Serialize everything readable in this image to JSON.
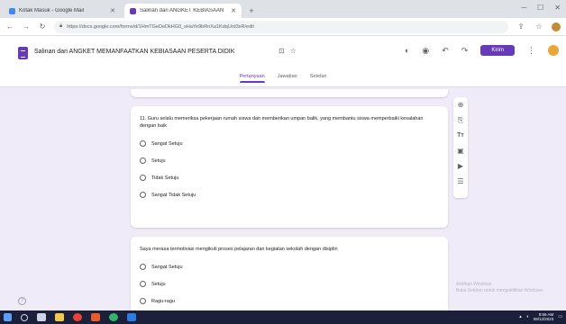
{
  "browser": {
    "tabs": [
      {
        "title": "Kotak Masuk - Google Mail",
        "active": false,
        "color": "#4285f4"
      },
      {
        "title": "Salinan dari ANGKET KEBIASAAN",
        "active": true,
        "color": "#673ab7"
      }
    ],
    "url": "https://docs.google.com/forms/d/1HmTGeDeDkHG0_sHaYe9bRnXa1KdqUrd3xR/edit"
  },
  "forms": {
    "doc_title": "Salinan dari ANGKET MEMANFAATKAN KEBIASAAN PESERTA DIDIK",
    "send_label": "Kirim",
    "tabs": [
      {
        "label": "Pertanyaan",
        "active": true
      },
      {
        "label": "Jawaban",
        "active": false
      },
      {
        "label": "Setelan",
        "active": false
      }
    ],
    "accent": "#673ab7"
  },
  "questions": [
    {
      "text": "11. Guru selalu memeriksa pekerjaan rumah siswa dan memberikan umpan balik, yang membantu siswa memperbaiki kesalahan dengan baik",
      "options": [
        "Sangat Setuju",
        "Setuju",
        "Tidak Setuju",
        "Sangat Tidak Setuju"
      ]
    },
    {
      "text": "Saya merasa termotivasi mengikuti proses pelajaran dan kegiatan sekolah dengan disiplin",
      "options": [
        "Sangat Setuju",
        "Setuju",
        "Ragu-ragu"
      ]
    }
  ],
  "sidebar_tools": [
    "add-question-icon",
    "import-questions-icon",
    "add-title-icon",
    "add-image-icon",
    "add-video-icon",
    "add-section-icon"
  ],
  "watermark": {
    "line1": "Aktifkan Windows",
    "line2": "Buka Setelan untuk mengaktifkan Windows"
  },
  "taskbar": {
    "time": "9:56 AM",
    "date": "08/12/2023"
  }
}
